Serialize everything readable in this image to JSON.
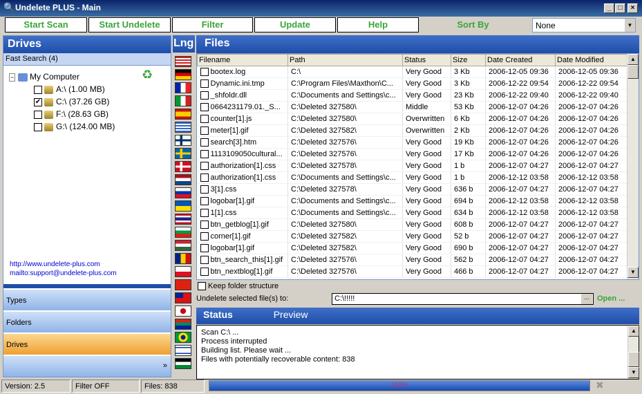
{
  "window": {
    "title": "Undelete PLUS - Main",
    "controls": [
      "_",
      "□",
      "×"
    ]
  },
  "toolbar": {
    "start_scan": "Start Scan",
    "start_undelete": "Start Undelete",
    "filter": "Filter",
    "update": "Update",
    "help": "Help",
    "sort_by_label": "Sort By",
    "sort_by_value": "None"
  },
  "left": {
    "title": "Drives",
    "fast_search": "Fast Search (4)",
    "root": "My Computer",
    "drives": [
      {
        "label": "A:\\  (1.00 MB)",
        "checked": false
      },
      {
        "label": "C:\\  (37.26 GB)",
        "checked": true
      },
      {
        "label": "F:\\  (28.63 GB)",
        "checked": false
      },
      {
        "label": "G:\\  (124.00 MB)",
        "checked": false
      }
    ],
    "link_web": "http://www.undelete-plus.com",
    "link_mail": "mailto:support@undelete-plus.com",
    "nav": [
      "Types",
      "Folders",
      "Drives"
    ],
    "more": "»"
  },
  "lng": {
    "title": "Lng",
    "flags": [
      "us",
      "de",
      "fr",
      "it",
      "es",
      "gr",
      "fi",
      "se",
      "dk",
      "nl",
      "ru",
      "ua",
      "th",
      "bg",
      "hu",
      "ro",
      "pl",
      "cn",
      "tw",
      "jp",
      "za",
      "br",
      "il",
      "jo"
    ]
  },
  "files": {
    "title": "Files",
    "columns": [
      "Filename",
      "Path",
      "Status",
      "Size",
      "Date Created",
      "Date Modified"
    ],
    "rows": [
      [
        "bootex.log",
        "C:\\",
        "Very Good",
        "3 Kb",
        "2006-12-05 09:36",
        "2006-12-05 09:36"
      ],
      [
        "Dynamic.ini.tmp",
        "C:\\Program Files\\Maxthon\\C...",
        "Very Good",
        "3 Kb",
        "2006-12-22 09:54",
        "2006-12-22 09:54"
      ],
      [
        "_shfoldr.dll",
        "C:\\Documents and Settings\\c...",
        "Very Good",
        "23 Kb",
        "2006-12-22 09:40",
        "2006-12-22 09:40"
      ],
      [
        "0664231179.01._S...",
        "C:\\Deleted 327580\\",
        "Middle",
        "53 Kb",
        "2006-12-07 04:26",
        "2006-12-07 04:26"
      ],
      [
        "counter[1].js",
        "C:\\Deleted 327580\\",
        "Overwritten",
        "6 Kb",
        "2006-12-07 04:26",
        "2006-12-07 04:26"
      ],
      [
        "meter[1].gif",
        "C:\\Deleted 327582\\",
        "Overwritten",
        "2 Kb",
        "2006-12-07 04:26",
        "2006-12-07 04:26"
      ],
      [
        "search[3].htm",
        "C:\\Deleted 327576\\",
        "Very Good",
        "19 Kb",
        "2006-12-07 04:26",
        "2006-12-07 04:26"
      ],
      [
        "1113109050cultural...",
        "C:\\Deleted 327576\\",
        "Very Good",
        "17 Kb",
        "2006-12-07 04:26",
        "2006-12-07 04:26"
      ],
      [
        "authorization[1].css",
        "C:\\Deleted 327578\\",
        "Very Good",
        "1 b",
        "2006-12-07 04:27",
        "2006-12-07 04:27"
      ],
      [
        "authorization[1].css",
        "C:\\Documents and Settings\\c...",
        "Very Good",
        "1 b",
        "2006-12-12 03:58",
        "2006-12-12 03:58"
      ],
      [
        "3[1].css",
        "C:\\Deleted 327578\\",
        "Very Good",
        "636 b",
        "2006-12-07 04:27",
        "2006-12-07 04:27"
      ],
      [
        "logobar[1].gif",
        "C:\\Documents and Settings\\c...",
        "Very Good",
        "694 b",
        "2006-12-12 03:58",
        "2006-12-12 03:58"
      ],
      [
        "1[1].css",
        "C:\\Documents and Settings\\c...",
        "Very Good",
        "634 b",
        "2006-12-12 03:58",
        "2006-12-12 03:58"
      ],
      [
        "btn_getblog[1].gif",
        "C:\\Deleted 327580\\",
        "Very Good",
        "608 b",
        "2006-12-07 04:27",
        "2006-12-07 04:27"
      ],
      [
        "corner[1].gif",
        "C:\\Deleted 327582\\",
        "Very Good",
        "52 b",
        "2006-12-07 04:27",
        "2006-12-07 04:27"
      ],
      [
        "logobar[1].gif",
        "C:\\Deleted 327582\\",
        "Very Good",
        "690 b",
        "2006-12-07 04:27",
        "2006-12-07 04:27"
      ],
      [
        "btn_search_this[1].gif",
        "C:\\Deleted 327576\\",
        "Very Good",
        "562 b",
        "2006-12-07 04:27",
        "2006-12-07 04:27"
      ],
      [
        "btn_nextblog[1].gif",
        "C:\\Deleted 327576\\",
        "Very Good",
        "466 b",
        "2006-12-07 04:27",
        "2006-12-07 04:27"
      ]
    ],
    "keep_folder": "Keep folder structure",
    "undelete_to_label": "Undelete selected file(s) to:",
    "undelete_to_value": "C:\\!!!!!",
    "browse": "...",
    "open": "Open ..."
  },
  "status": {
    "tab_status": "Status",
    "tab_preview": "Preview",
    "lines": [
      "Scan C:\\ ...",
      "Process interrupted",
      "Building list. Please wait ...",
      "Files with potentially recoverable content: 838"
    ]
  },
  "statusbar": {
    "version": "Version: 2.5",
    "filter": "Filter OFF",
    "files": "Files: 838",
    "progress_text": "100%",
    "progress": 100
  }
}
